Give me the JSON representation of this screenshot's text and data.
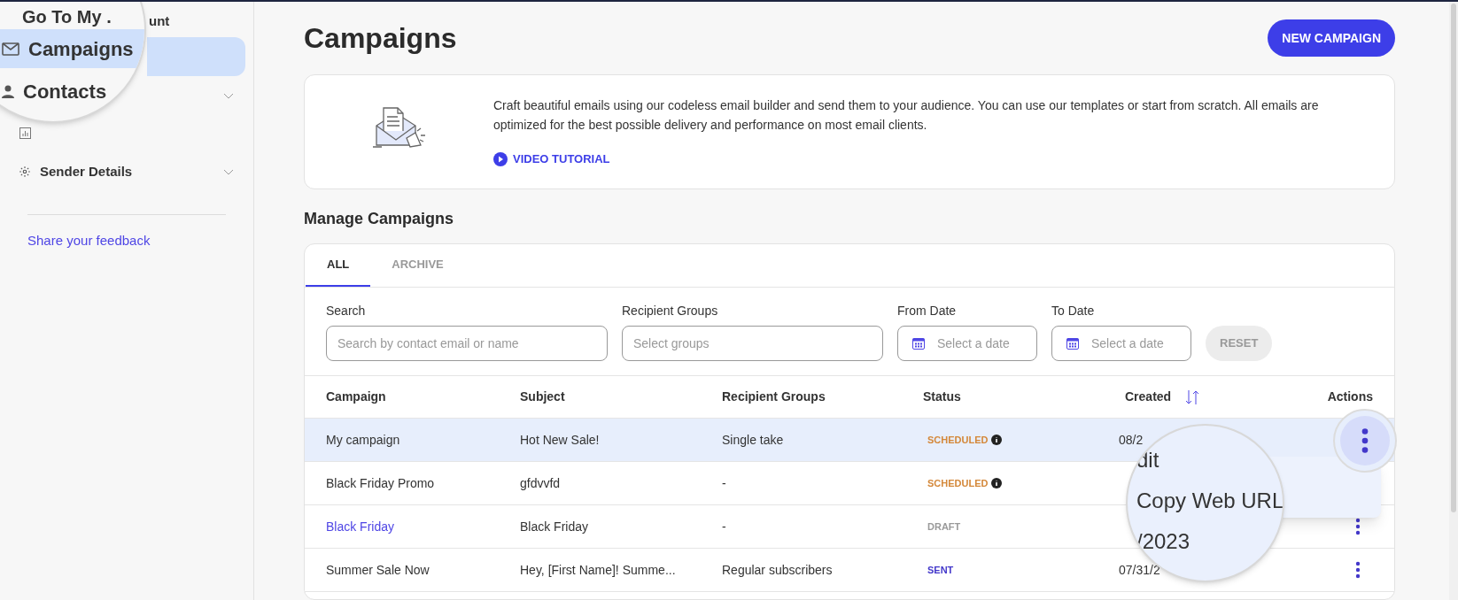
{
  "sidebar": {
    "account_fragment": "unt",
    "sender_details": "Sender Details",
    "feedback_link": "Share your feedback",
    "magnifier": {
      "lines": [
        {
          "kind": "cut",
          "text": "Go To My ."
        },
        {
          "kind": "nav",
          "text": "Campaigns",
          "selected": true
        },
        {
          "kind": "nav",
          "text": "Contacts",
          "selected": false
        }
      ]
    }
  },
  "page": {
    "title": "Campaigns",
    "new_button": "NEW CAMPAIGN"
  },
  "intro": {
    "text": "Craft beautiful emails using our codeless email builder and send them to your audience. You can use our templates or start from scratch. All emails are optimized for the best possible delivery and performance on most email clients.",
    "video_link": "VIDEO TUTORIAL"
  },
  "section_title": "Manage Campaigns",
  "tabs": [
    {
      "label": "ALL",
      "selected": true
    },
    {
      "label": "ARCHIVE",
      "selected": false
    }
  ],
  "filters": {
    "search": {
      "label": "Search",
      "placeholder": "Search by contact email or name"
    },
    "groups": {
      "label": "Recipient Groups",
      "placeholder": "Select groups"
    },
    "from": {
      "label": "From Date",
      "placeholder": "Select a date"
    },
    "to": {
      "label": "To Date",
      "placeholder": "Select a date"
    },
    "reset": "RESET"
  },
  "table": {
    "columns": [
      "Campaign",
      "Subject",
      "Recipient Groups",
      "Status",
      "Created",
      "Actions"
    ],
    "rows": [
      {
        "campaign": "My campaign",
        "link": false,
        "subject": "Hot New Sale!",
        "groups": "Single take",
        "status": "SCHEDULED",
        "color": "#d4883a",
        "info": true,
        "created": "08/2",
        "selected": true
      },
      {
        "campaign": "Black Friday Promo",
        "link": false,
        "subject": "gfdvvfd",
        "groups": "-",
        "status": "SCHEDULED",
        "color": "#d4883a",
        "info": true,
        "selected": false
      },
      {
        "campaign": "Black Friday",
        "link": true,
        "subject": "Black Friday",
        "groups": "-",
        "status": "DRAFT",
        "color": "#9a9a9a",
        "info": false,
        "selected": false
      },
      {
        "campaign": "Summer Sale Now",
        "link": false,
        "subject": "Hey, [First Name]! Summe...",
        "groups": "Regular subscribers",
        "status": "SENT",
        "color": "#4338ca",
        "info": false,
        "created": "07/31/2",
        "selected": false
      }
    ]
  },
  "actions_menu": {
    "magnified_lines": [
      "dit",
      "Copy Web URL",
      "/2023"
    ]
  }
}
